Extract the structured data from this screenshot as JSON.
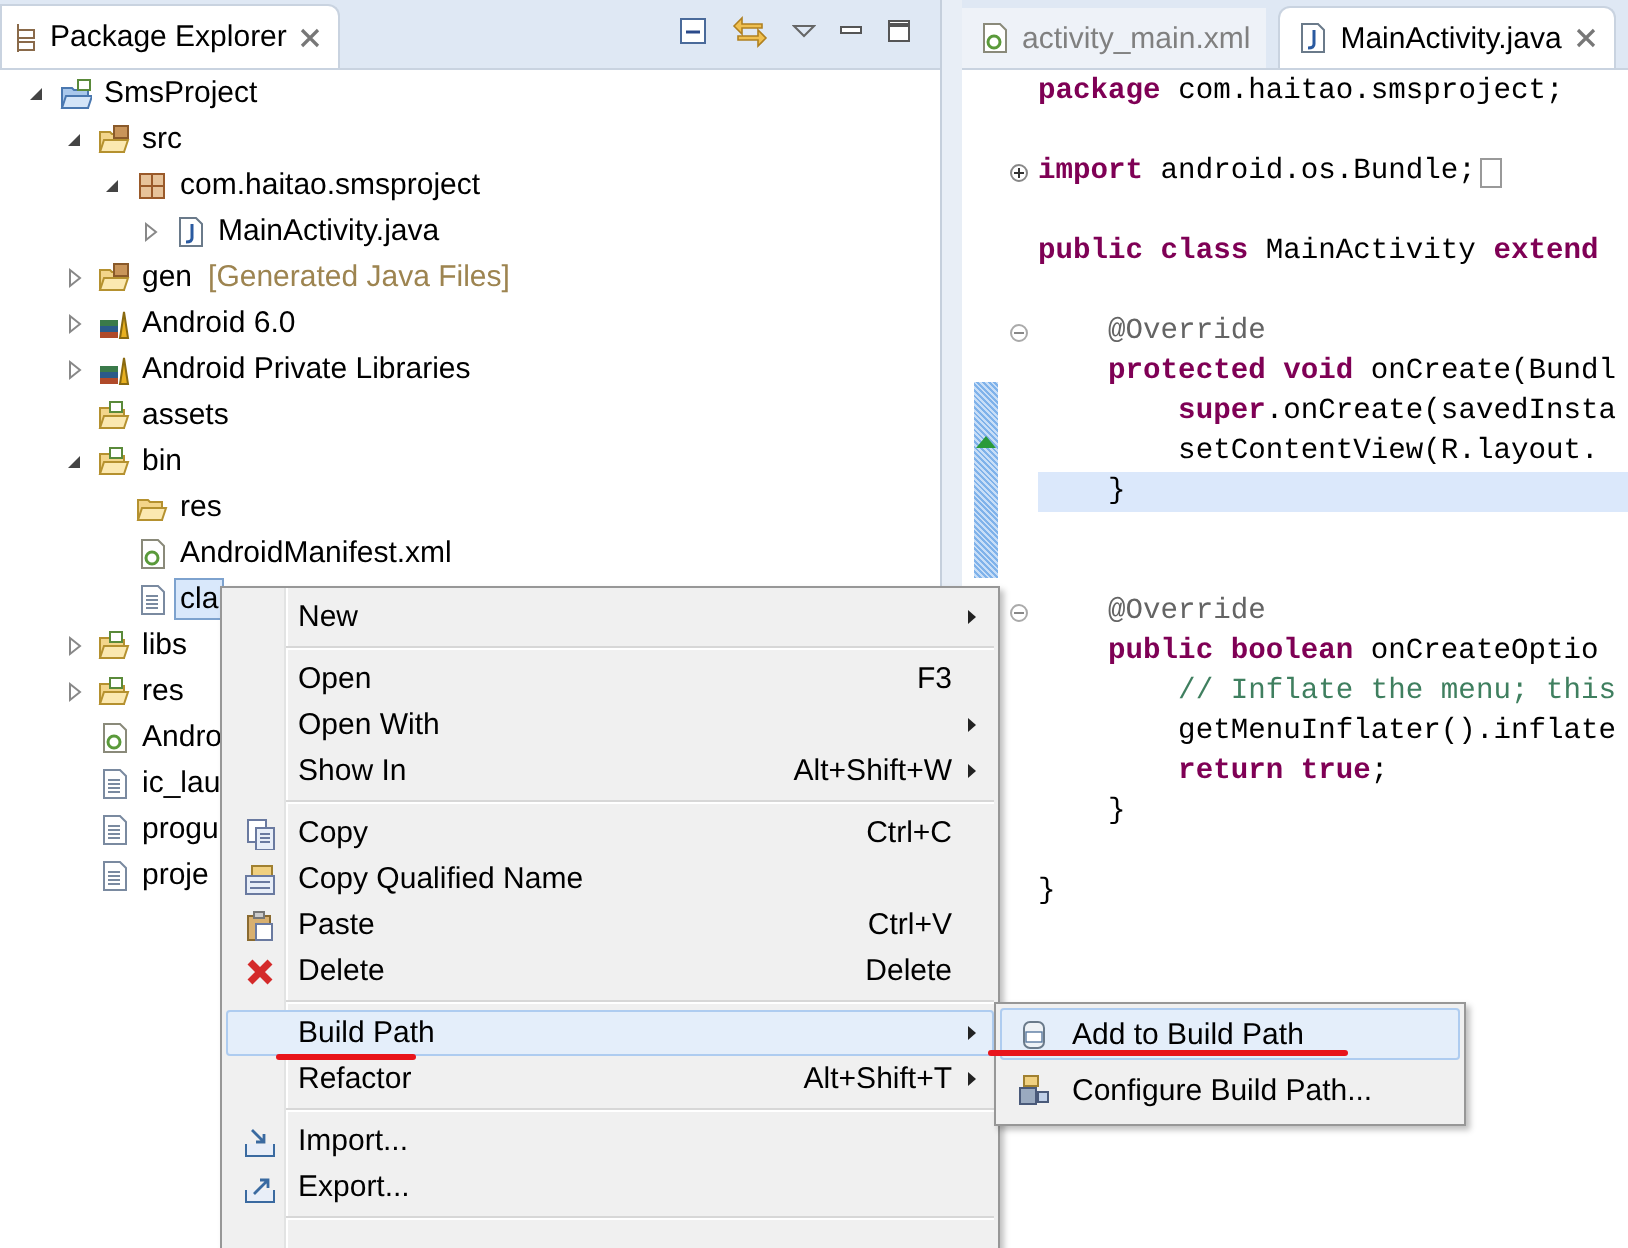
{
  "explorer": {
    "title": "Package Explorer",
    "tree": [
      {
        "label": "SmsProject",
        "kind": "project",
        "expanded": true,
        "selected": false,
        "children": [
          {
            "label": "src",
            "kind": "source-folder",
            "expanded": true,
            "selected": false,
            "children": [
              {
                "label": "com.haitao.smsproject",
                "kind": "package",
                "expanded": true,
                "selected": false,
                "children": [
                  {
                    "label": "MainActivity.java",
                    "kind": "java-file",
                    "expanded": false,
                    "selected": false
                  }
                ]
              }
            ]
          },
          {
            "label": "gen",
            "decoration": "[Generated Java Files]",
            "kind": "source-folder",
            "expanded": false,
            "selected": false
          },
          {
            "label": "Android 6.0",
            "kind": "library",
            "expanded": false,
            "selected": false
          },
          {
            "label": "Android Private Libraries",
            "kind": "library",
            "expanded": false,
            "selected": false
          },
          {
            "label": "assets",
            "kind": "folder",
            "selected": false
          },
          {
            "label": "bin",
            "kind": "folder",
            "expanded": true,
            "selected": false,
            "children": [
              {
                "label": "res",
                "kind": "plain-folder",
                "selected": false
              },
              {
                "label": "AndroidManifest.xml",
                "kind": "xml-file",
                "selected": false
              },
              {
                "label": "cla",
                "kind": "file",
                "selected": true
              }
            ]
          },
          {
            "label": "libs",
            "kind": "folder",
            "expanded": false,
            "selected": false
          },
          {
            "label": "res",
            "kind": "folder",
            "expanded": false,
            "selected": false
          },
          {
            "label": "Andro",
            "kind": "xml-file",
            "selected": false
          },
          {
            "label": "ic_lau",
            "kind": "file",
            "selected": false
          },
          {
            "label": "progu",
            "kind": "file",
            "selected": false
          },
          {
            "label": "proje",
            "kind": "file",
            "selected": false
          }
        ]
      }
    ]
  },
  "editor": {
    "tabs": [
      {
        "label": "activity_main.xml",
        "kind": "xml-file",
        "selected": false
      },
      {
        "label": "MainActivity.java",
        "kind": "java-file",
        "selected": true
      }
    ],
    "lines": [
      {
        "current": false,
        "tokens": [
          {
            "kind": "keyword",
            "text": "package"
          },
          {
            "kind": "plain",
            "text": " com.haitao.smsproject;"
          }
        ]
      },
      {
        "current": false
      },
      {
        "current": false,
        "kind": "folded",
        "tokens": [
          {
            "kind": "keyword",
            "text": "import"
          },
          {
            "kind": "plain",
            "text": " android.os.Bundle;"
          }
        ]
      },
      {
        "current": false
      },
      {
        "current": false,
        "tokens": [
          {
            "kind": "keyword",
            "text": "public"
          },
          {
            "kind": "keyword",
            "text": " class"
          },
          {
            "kind": "plain",
            "text": " MainActivity "
          },
          {
            "kind": "keyword",
            "text": "extend"
          }
        ]
      },
      {
        "current": false
      },
      {
        "current": false,
        "kind": "foldable",
        "tokens": [
          {
            "kind": "annotation",
            "text": "    @Override"
          }
        ]
      },
      {
        "current": false,
        "tokens": [
          {
            "kind": "keyword",
            "text": "    protected"
          },
          {
            "kind": "keyword",
            "text": " void"
          },
          {
            "kind": "plain",
            "text": " onCreate(Bundl"
          }
        ]
      },
      {
        "current": false,
        "tokens": [
          {
            "kind": "keyword",
            "text": "        super"
          },
          {
            "kind": "plain",
            "text": ".onCreate(savedInsta"
          }
        ]
      },
      {
        "current": false,
        "tokens": [
          {
            "kind": "plain",
            "text": "        setContentView(R.layout."
          }
        ]
      },
      {
        "current": true,
        "tokens": [
          {
            "kind": "plain",
            "text": "    }"
          }
        ]
      },
      {
        "current": false
      },
      {
        "current": false
      },
      {
        "current": false,
        "kind": "foldable",
        "tokens": [
          {
            "kind": "annotation",
            "text": "    @Override"
          }
        ]
      },
      {
        "current": false,
        "tokens": [
          {
            "kind": "keyword",
            "text": "    public"
          },
          {
            "kind": "keyword",
            "text": " boolean"
          },
          {
            "kind": "plain",
            "text": " onCreateOptio"
          }
        ]
      },
      {
        "current": false,
        "tokens": [
          {
            "kind": "comment",
            "text": "        // Inflate the menu; this"
          }
        ]
      },
      {
        "current": false,
        "tokens": [
          {
            "kind": "plain",
            "text": "        getMenuInflater().inflate"
          }
        ]
      },
      {
        "current": false,
        "tokens": [
          {
            "kind": "keyword",
            "text": "        return"
          },
          {
            "kind": "keyword",
            "text": " true"
          },
          {
            "kind": "plain",
            "text": ";"
          }
        ]
      },
      {
        "current": false,
        "tokens": [
          {
            "kind": "plain",
            "text": "    }"
          }
        ]
      },
      {
        "current": false
      },
      {
        "current": false,
        "tokens": [
          {
            "kind": "plain",
            "text": "}"
          }
        ]
      }
    ]
  },
  "context_menu": {
    "items": [
      {
        "kind": "item",
        "label": "New",
        "submenu": true,
        "selected": false
      },
      {
        "kind": "separator"
      },
      {
        "kind": "item",
        "label": "Open",
        "shortcut": "F3",
        "submenu": false,
        "selected": false
      },
      {
        "kind": "item",
        "label": "Open With",
        "submenu": true,
        "selected": false
      },
      {
        "kind": "item",
        "label": "Show In",
        "shortcut": "Alt+Shift+W",
        "submenu": true,
        "selected": false
      },
      {
        "kind": "separator"
      },
      {
        "kind": "copy",
        "label": "Copy",
        "shortcut": "Ctrl+C",
        "submenu": false,
        "selected": false
      },
      {
        "kind": "qualified",
        "label": "Copy Qualified Name",
        "submenu": false,
        "selected": false
      },
      {
        "kind": "paste",
        "label": "Paste",
        "shortcut": "Ctrl+V",
        "submenu": false,
        "selected": false
      },
      {
        "kind": "delete",
        "label": "Delete",
        "shortcut": "Delete",
        "submenu": false,
        "selected": false
      },
      {
        "kind": "separator"
      },
      {
        "kind": "item",
        "label": "Build Path",
        "submenu": true,
        "selected": true
      },
      {
        "kind": "item",
        "label": "Refactor",
        "shortcut": "Alt+Shift+T",
        "submenu": true,
        "selected": false
      },
      {
        "kind": "separator"
      },
      {
        "kind": "import",
        "label": "Import...",
        "submenu": false,
        "selected": false
      },
      {
        "kind": "export",
        "label": "Export...",
        "submenu": false,
        "selected": false
      },
      {
        "kind": "separator"
      }
    ]
  },
  "submenu": {
    "items": [
      {
        "kind": "jar",
        "label": "Add to Build Path",
        "selected": true
      },
      {
        "kind": "config",
        "label": "Configure Build Path...",
        "selected": false
      }
    ]
  }
}
